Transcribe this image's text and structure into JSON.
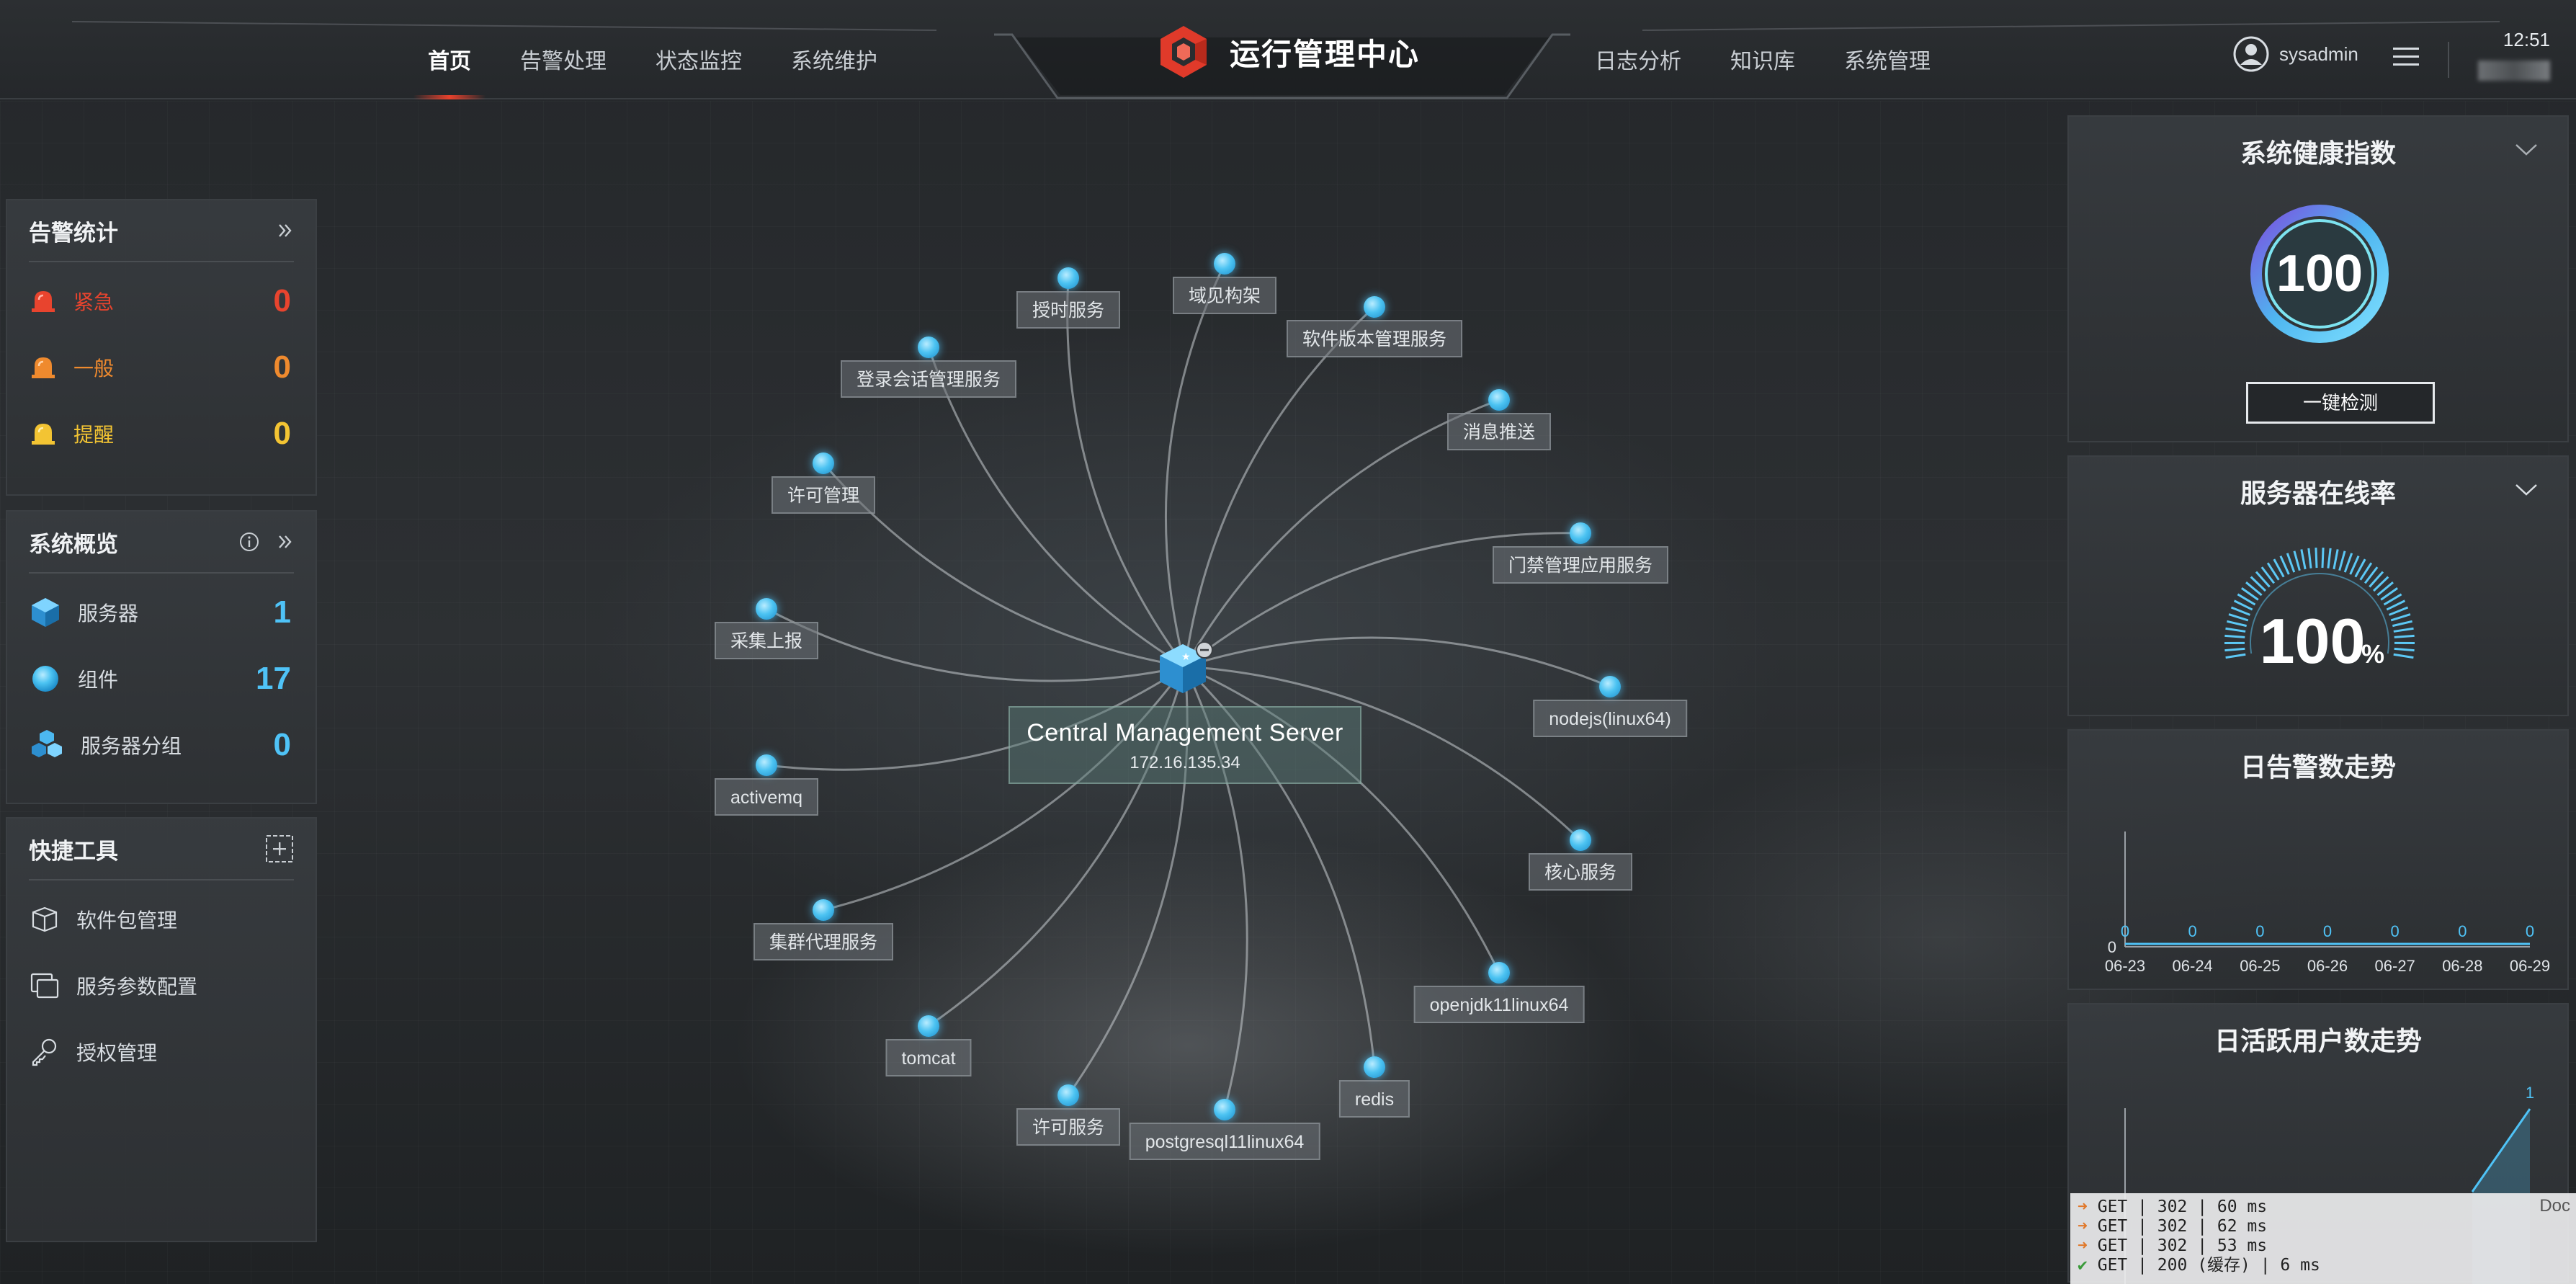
{
  "header": {
    "brand_title": "运行管理中心",
    "nav_left": [
      "首页",
      "告警处理",
      "状态监控",
      "系统维护"
    ],
    "nav_right": [
      "日志分析",
      "知识库",
      "系统管理"
    ],
    "active_index": 0,
    "username": "sysadmin",
    "clock": "12:51",
    "brand_color": "#e03a2a"
  },
  "alarm_stats": {
    "title": "告警统计",
    "items": [
      {
        "label": "紧急",
        "value": "0",
        "color": "#e8442e",
        "icon": "bell-icon"
      },
      {
        "label": "一般",
        "value": "0",
        "color": "#ef8a2e",
        "icon": "bell-icon"
      },
      {
        "label": "提醒",
        "value": "0",
        "color": "#f3c433",
        "icon": "bell-icon"
      }
    ]
  },
  "overview": {
    "title": "系统概览",
    "items": [
      {
        "label": "服务器",
        "value": "1",
        "icon": "server-cube-icon"
      },
      {
        "label": "组件",
        "value": "17",
        "icon": "component-dot-icon"
      },
      {
        "label": "服务器分组",
        "value": "0",
        "icon": "server-group-icon"
      }
    ],
    "value_color": "#4fc3f7"
  },
  "tools": {
    "title": "快捷工具",
    "items": [
      {
        "label": "软件包管理",
        "icon": "package-icon"
      },
      {
        "label": "服务参数配置",
        "icon": "config-icon"
      },
      {
        "label": "授权管理",
        "icon": "key-icon"
      }
    ]
  },
  "topology": {
    "center": {
      "name": "Central Management Server",
      "ip": "172.16.135.34"
    },
    "nodes": [
      "授时服务",
      "域见构架",
      "软件版本管理服务",
      "登录会话管理服务",
      "消息推送",
      "许可管理",
      "门禁管理应用服务",
      "采集上报",
      "nodejs(linux64)",
      "activemq",
      "核心服务",
      "集群代理服务",
      "openjdk11linux64",
      "tomcat",
      "redis",
      "许可服务",
      "postgresql11linux64"
    ]
  },
  "health": {
    "title": "系统健康指数",
    "score": "100",
    "button": "一键检测"
  },
  "online": {
    "title": "服务器在线率",
    "value": "100",
    "unit": "%",
    "level": 1.0
  },
  "daily_alarm": {
    "title": "日告警数走势",
    "chart_data": {
      "type": "line",
      "categories": [
        "06-23",
        "06-24",
        "06-25",
        "06-26",
        "06-27",
        "06-28",
        "06-29"
      ],
      "values": [
        0,
        0,
        0,
        0,
        0,
        0,
        0
      ],
      "y_tick": "0"
    }
  },
  "daily_active": {
    "title": "日活跃用户数走势",
    "chart_data": {
      "type": "line",
      "last_label": "1"
    }
  },
  "debug": {
    "doc": "Doc",
    "lines": [
      {
        "mark": "➜",
        "text": "GET | 302 | 60 ms",
        "ok": false
      },
      {
        "mark": "➜",
        "text": "GET | 302 | 62 ms",
        "ok": false
      },
      {
        "mark": "➜",
        "text": "GET | 302 | 53 ms",
        "ok": false
      },
      {
        "mark": "✔",
        "text": "GET | 200 (缓存) | 6 ms",
        "ok": true
      }
    ]
  }
}
